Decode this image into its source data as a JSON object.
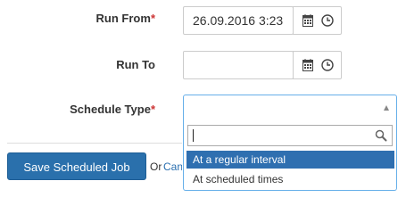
{
  "form": {
    "run_from": {
      "label": "Run From",
      "required_marker": "*",
      "value": "26.09.2016 3:23",
      "calendar_icon": "calendar-icon",
      "clock_icon": "clock-icon"
    },
    "run_to": {
      "label": "Run To",
      "value": "",
      "calendar_icon": "calendar-icon",
      "clock_icon": "clock-icon"
    },
    "schedule_type": {
      "label": "Schedule Type",
      "required_marker": "*",
      "selected": "",
      "search_value": "",
      "options": [
        "At a regular interval",
        "At scheduled times"
      ],
      "highlighted_option": "At a regular interval"
    }
  },
  "actions": {
    "save_label": "Save Scheduled Job",
    "or_text": "Or",
    "cancel_label": "Cancel"
  },
  "colors": {
    "primary_button": "#2a70ac",
    "highlight": "#2f6fb0",
    "required": "#cc3333",
    "focus_border": "#66afe9"
  }
}
